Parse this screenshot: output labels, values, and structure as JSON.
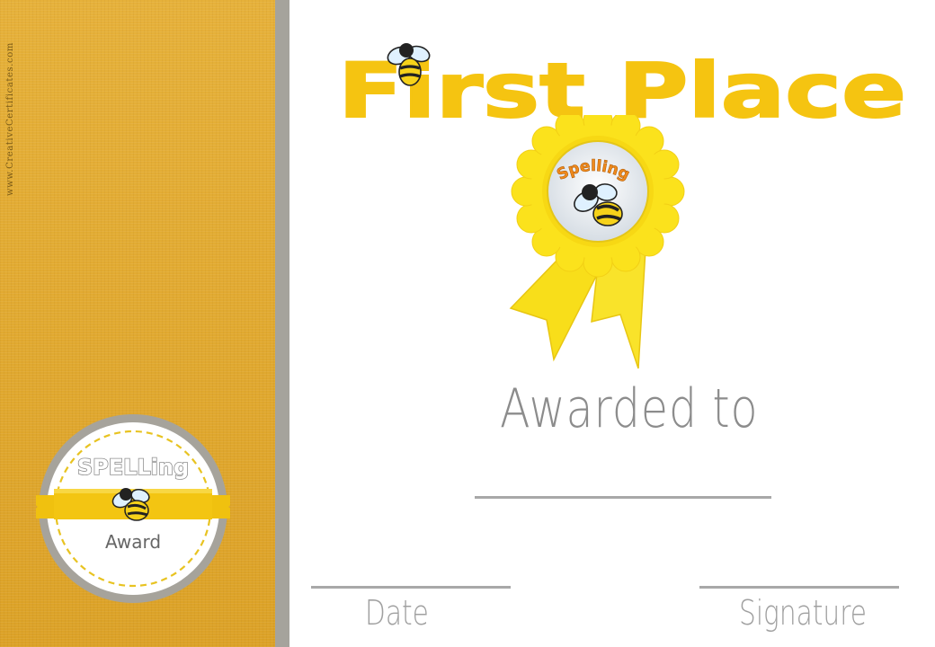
{
  "certificate": {
    "website": "www.CreativeCertificates.com",
    "title": "First Place",
    "rosette_text": "Spelling",
    "awarded_to": "Awarded to",
    "date_label": "Date",
    "signature_label": "Signature",
    "seal": {
      "top_text": "SPELLing",
      "bottom_text": "Award"
    }
  },
  "colors": {
    "band_gold": "#e0a829",
    "stripe_gray": "#a5a39c",
    "title_yellow": "#f5c411",
    "rosette_yellow": "#fbe21c",
    "rosette_text_orange": "#f08a1c",
    "text_gray": "#8c8c8c"
  }
}
